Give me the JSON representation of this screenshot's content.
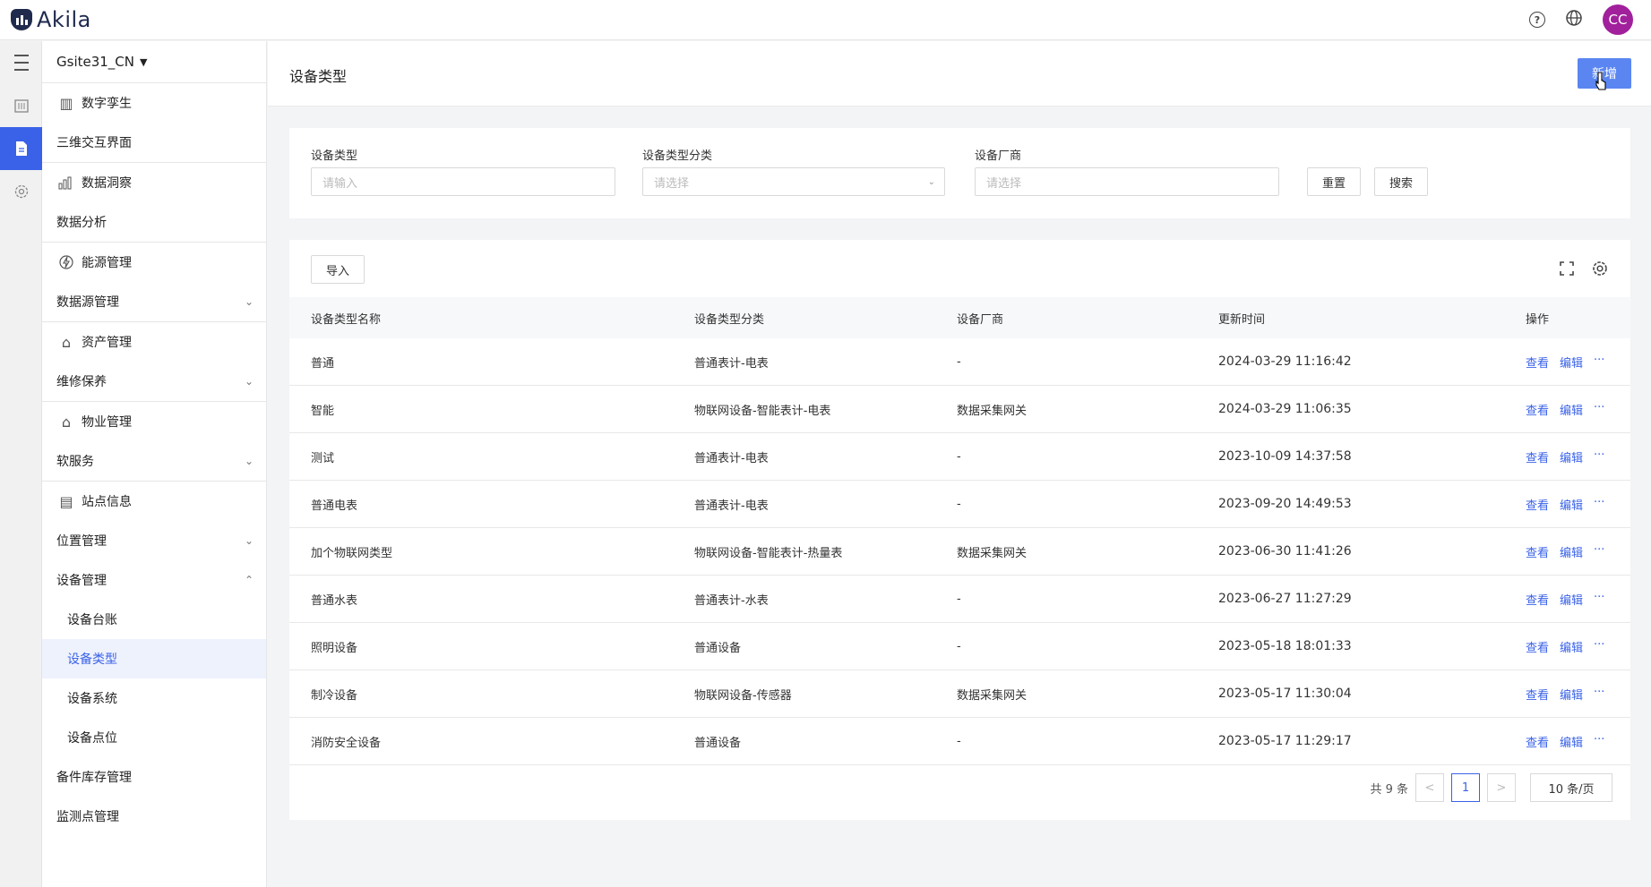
{
  "app": {
    "logo_text": "Akila",
    "avatar": "CC",
    "colors": {
      "accent": "#3a62e8",
      "primary_button": "#5b86f2",
      "avatar_bg": "#a1209c"
    }
  },
  "header_icons": [
    "help-icon",
    "globe-icon"
  ],
  "rail": [
    {
      "icon": "menu-icon"
    },
    {
      "icon": "building-icon"
    },
    {
      "icon": "document-icon",
      "active": true
    },
    {
      "icon": "settings-icon"
    }
  ],
  "sidebar": {
    "site": "Gsite31_CN",
    "groups": [
      {
        "title": "数字孪生",
        "icon": "building-icon",
        "items": [
          {
            "label": "三维交互界面"
          }
        ]
      },
      {
        "title": "数据洞察",
        "icon": "bar-chart-icon",
        "items": [
          {
            "label": "数据分析"
          }
        ]
      },
      {
        "title": "能源管理",
        "icon": "energy-icon",
        "items": [
          {
            "label": "数据源管理"
          }
        ]
      },
      {
        "title": "资产管理",
        "icon": "asset-icon",
        "items": [
          {
            "label": "维修保养"
          }
        ]
      },
      {
        "title": "物业管理",
        "icon": "property-icon",
        "items": [
          {
            "label": "软服务"
          }
        ]
      },
      {
        "title": "站点信息",
        "icon": "site-icon",
        "items": [
          {
            "label": "位置管理"
          },
          {
            "label": "设备管理"
          }
        ],
        "sub_items": [
          {
            "label": "设备台账"
          },
          {
            "label": "设备类型",
            "active": true
          },
          {
            "label": "设备系统"
          },
          {
            "label": "设备点位"
          }
        ],
        "after": [
          {
            "label": "备件库存管理"
          },
          {
            "label": "监测点管理"
          }
        ]
      }
    ]
  },
  "page": {
    "title": "设备类型",
    "add_button": "新增"
  },
  "filters": {
    "type_label": "设备类型",
    "type_placeholder": "请输入",
    "category_label": "设备类型分类",
    "category_placeholder": "请选择",
    "vendor_label": "设备厂商",
    "vendor_placeholder": "请选择",
    "reset": "重置",
    "search": "搜索"
  },
  "table": {
    "import": "导入",
    "columns": [
      "设备类型名称",
      "设备类型分类",
      "设备厂商",
      "更新时间",
      "操作"
    ],
    "action_view": "查看",
    "action_edit": "编辑",
    "action_more": "···",
    "rows": [
      [
        "普通",
        "普通表计-电表",
        "-",
        "2024-03-29 11:16:42"
      ],
      [
        "智能",
        "物联网设备-智能表计-电表",
        "数据采集网关",
        "2024-03-29 11:06:35"
      ],
      [
        "测试",
        "普通表计-电表",
        "-",
        "2023-10-09 14:37:58"
      ],
      [
        "普通电表",
        "普通表计-电表",
        "-",
        "2023-09-20 14:49:53"
      ],
      [
        "加个物联网类型",
        "物联网设备-智能表计-热量表",
        "数据采集网关",
        "2023-06-30 11:41:26"
      ],
      [
        "普通水表",
        "普通表计-水表",
        "-",
        "2023-06-27 11:27:29"
      ],
      [
        "照明设备",
        "普通设备",
        "-",
        "2023-05-18 18:01:33"
      ],
      [
        "制冷设备",
        "物联网设备-传感器",
        "数据采集网关",
        "2023-05-17 11:30:04"
      ],
      [
        "消防安全设备",
        "普通设备",
        "-",
        "2023-05-17 11:29:17"
      ]
    ]
  },
  "pagination": {
    "total": "共 9 条",
    "prev": "<",
    "page": "1",
    "next": ">",
    "page_size": "10 条/页"
  }
}
